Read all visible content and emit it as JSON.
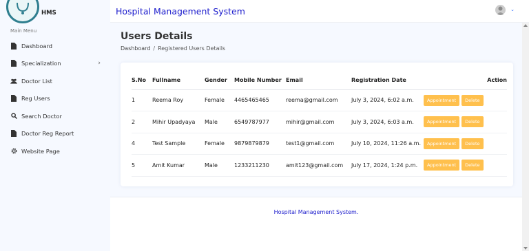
{
  "brand": {
    "name": "HMS"
  },
  "sidebar": {
    "menu_title": "Main Menu",
    "items": [
      {
        "label": "Dashboard",
        "icon": "file-icon"
      },
      {
        "label": "Specialization",
        "icon": "file-icon",
        "has_submenu": true
      },
      {
        "label": "Doctor List",
        "icon": "people-icon"
      },
      {
        "label": "Reg Users",
        "icon": "file-icon"
      },
      {
        "label": "Search Doctor",
        "icon": "search-icon"
      },
      {
        "label": "Doctor Reg Report",
        "icon": "file-icon"
      },
      {
        "label": "Website Page",
        "icon": "gear-icon"
      }
    ]
  },
  "header": {
    "title": "Hospital Management System"
  },
  "page": {
    "title": "Users Details",
    "breadcrumb": {
      "home": "Dashboard",
      "separator": "/",
      "current": "Registered Users Details"
    }
  },
  "table": {
    "headers": {
      "sno": "S.No",
      "fullname": "Fullname",
      "gender": "Gender",
      "mobile": "Mobile Number",
      "email": "Email",
      "regdate": "Registration Date",
      "action": "Action"
    },
    "rows": [
      {
        "sno": "1",
        "fullname": "Reema Roy",
        "gender": "Female",
        "mobile": "4465465465",
        "email": "reema@gmail.com",
        "regdate": "July 3, 2024, 6:02 a.m.",
        "btn_appointment": "Appointment",
        "btn_delete": "Delete"
      },
      {
        "sno": "2",
        "fullname": "Mihir Upadyaya",
        "gender": "Male",
        "mobile": "6549787977",
        "email": "mihir@gmail.com",
        "regdate": "July 3, 2024, 6:03 a.m.",
        "btn_appointment": "Appointment",
        "btn_delete": "Delete"
      },
      {
        "sno": "4",
        "fullname": "Test Sample",
        "gender": "Female",
        "mobile": "9879879879",
        "email": "test1@gmail.com",
        "regdate": "July 10, 2024, 11:26 a.m.",
        "btn_appointment": "Appointment",
        "btn_delete": "Delete"
      },
      {
        "sno": "5",
        "fullname": "Amit Kumar",
        "gender": "Male",
        "mobile": "1233211230",
        "email": "amit123@gmail.com",
        "regdate": "July 17, 2024, 1:24 p.m.",
        "btn_appointment": "Appointment",
        "btn_delete": "Delete"
      }
    ]
  },
  "footer": {
    "text": "Hospital Management System."
  },
  "colors": {
    "accent": "#1a1acc",
    "button": "#ffc04d",
    "background": "#f6f9ff"
  }
}
